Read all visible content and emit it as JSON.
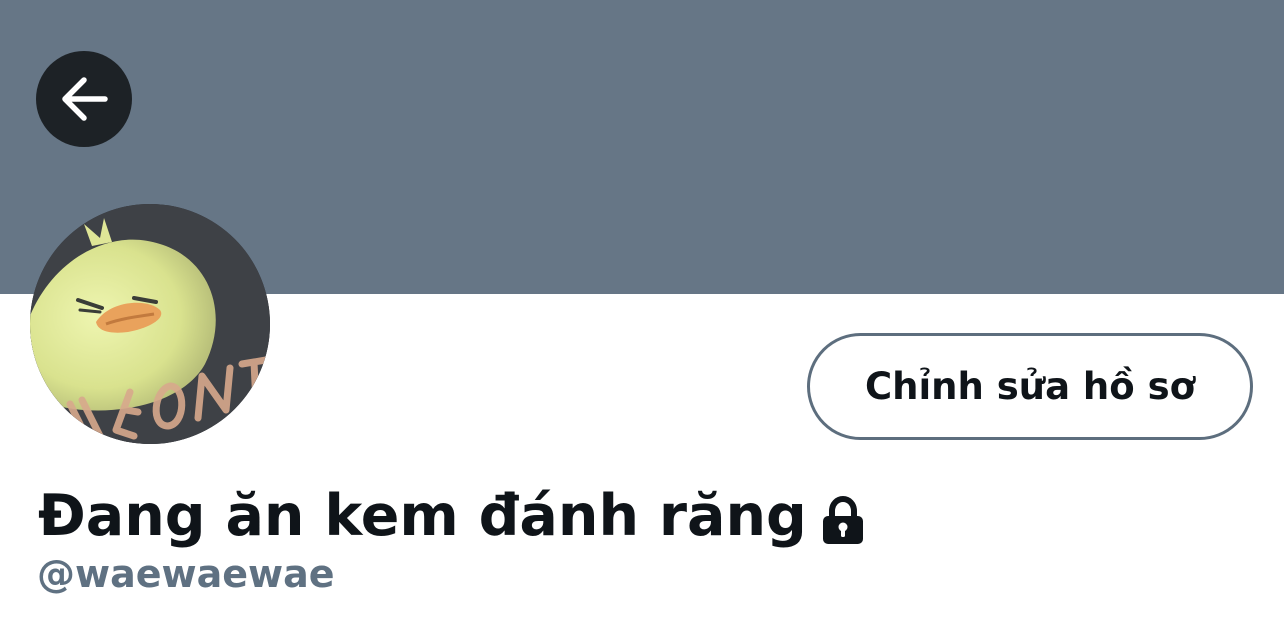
{
  "profile": {
    "display_name": "Đang ăn kem đánh răng",
    "handle": "@waewaewae",
    "edit_button_label": "Chỉnh sửa hồ sơ"
  },
  "icons": {
    "back": "arrow-left-icon",
    "protected": "lock-icon"
  },
  "colors": {
    "banner": "#667686",
    "back_button_bg": "#1d2226",
    "text_primary": "#0f1419",
    "text_secondary": "#5f7182",
    "button_border": "#5d6e7e"
  }
}
